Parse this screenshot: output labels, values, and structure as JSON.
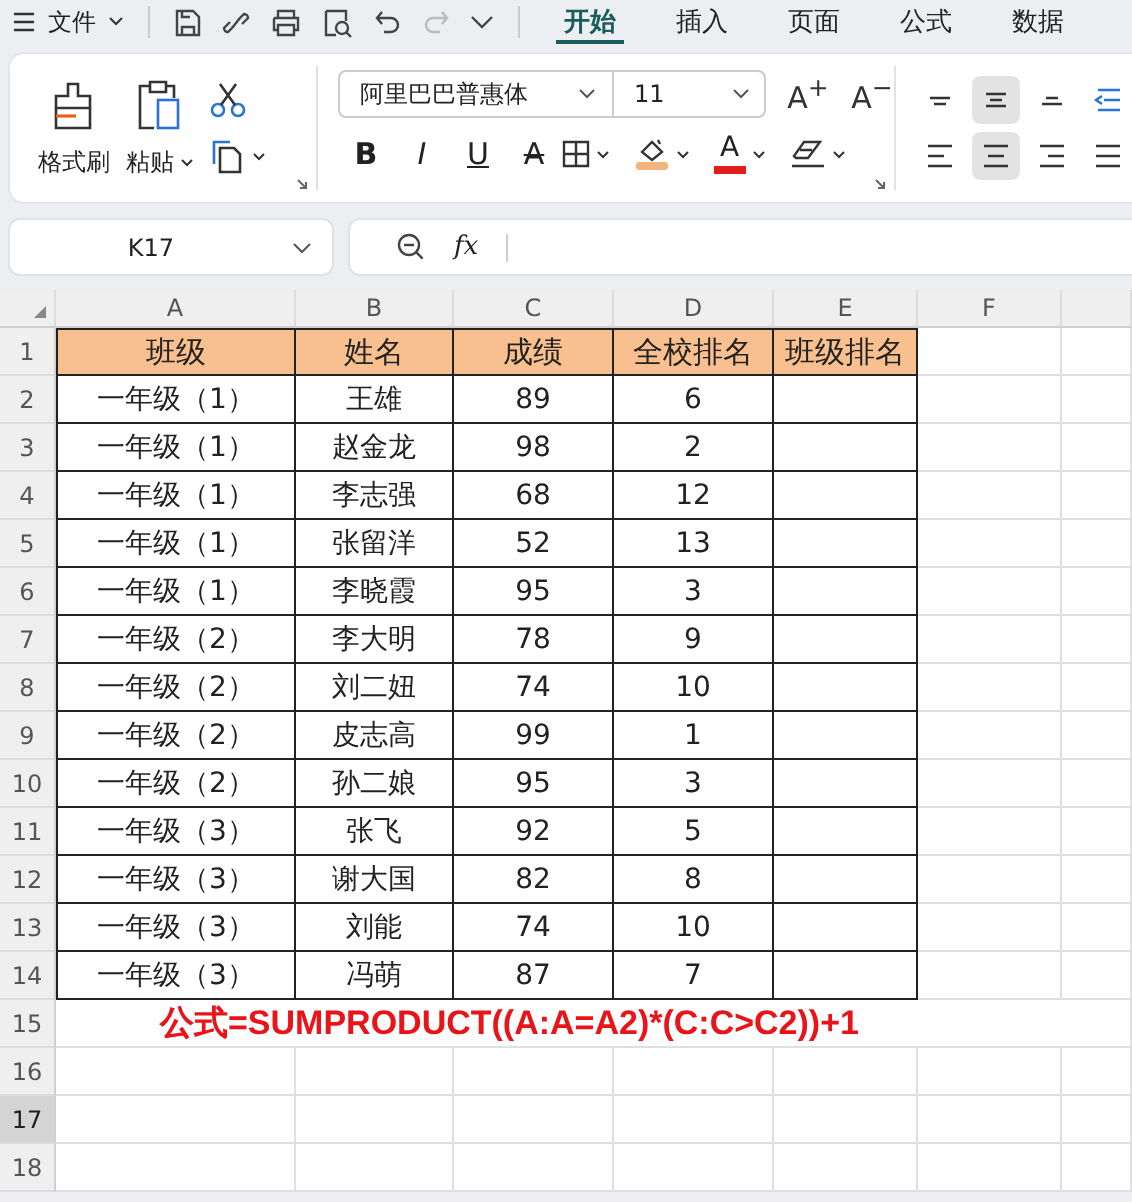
{
  "top_bar": {
    "menu_label": "文件",
    "tabs": [
      {
        "label": "开始",
        "selected": true
      },
      {
        "label": "插入",
        "selected": false
      },
      {
        "label": "页面",
        "selected": false
      },
      {
        "label": "公式",
        "selected": false
      },
      {
        "label": "数据",
        "selected": false
      }
    ]
  },
  "ribbon": {
    "format_painter_label": "格式刷",
    "paste_label": "粘贴",
    "font_name": "阿里巴巴普惠体",
    "font_size": "11",
    "grow_font": "A$^{+}$",
    "shrink_font": "A$^{−}$",
    "style_buttons": [
      {
        "kind": "bold",
        "label": "B"
      },
      {
        "kind": "italic",
        "label": "I"
      },
      {
        "kind": "underline",
        "label": "U"
      },
      {
        "kind": "strike",
        "label": "A"
      }
    ],
    "font_color_label": "A",
    "align_buttons": [
      {
        "kind": "top",
        "selected": false
      },
      {
        "kind": "middle",
        "selected": true
      },
      {
        "kind": "bottom",
        "selected": false
      },
      {
        "kind": "outdent",
        "selected": false
      },
      {
        "kind": "left",
        "selected": false
      },
      {
        "kind": "center",
        "selected": true
      },
      {
        "kind": "right",
        "selected": false
      },
      {
        "kind": "justify",
        "selected": false
      }
    ]
  },
  "formula_bar": {
    "name_box": "K17",
    "function_label": "fx"
  },
  "sheet": {
    "columns": [
      "A",
      "B",
      "C",
      "D",
      "E",
      "F"
    ],
    "row_numbers": [
      {
        "label": "1",
        "selected": false
      },
      {
        "label": "2",
        "selected": false
      },
      {
        "label": "3",
        "selected": false
      },
      {
        "label": "4",
        "selected": false
      },
      {
        "label": "5",
        "selected": false
      },
      {
        "label": "6",
        "selected": false
      },
      {
        "label": "7",
        "selected": false
      },
      {
        "label": "8",
        "selected": false
      },
      {
        "label": "9",
        "selected": false
      },
      {
        "label": "10",
        "selected": false
      },
      {
        "label": "11",
        "selected": false
      },
      {
        "label": "12",
        "selected": false
      },
      {
        "label": "13",
        "selected": false
      },
      {
        "label": "14",
        "selected": false
      },
      {
        "label": "15",
        "selected": false
      },
      {
        "label": "16",
        "selected": false
      },
      {
        "label": "17",
        "selected": true
      },
      {
        "label": "18",
        "selected": false
      }
    ],
    "header": [
      "班级",
      "姓名",
      "成绩",
      "全校排名",
      "班级排名"
    ],
    "rows": [
      [
        "一年级（1）",
        "王雄",
        "89",
        "6"
      ],
      [
        "一年级（1）",
        "赵金龙",
        "98",
        "2"
      ],
      [
        "一年级（1）",
        "李志强",
        "68",
        "12"
      ],
      [
        "一年级（1）",
        "张留洋",
        "52",
        "13"
      ],
      [
        "一年级（1）",
        "李晓霞",
        "95",
        "3"
      ],
      [
        "一年级（2）",
        "李大明",
        "78",
        "9"
      ],
      [
        "一年级（2）",
        "刘二妞",
        "74",
        "10"
      ],
      [
        "一年级（2）",
        "皮志高",
        "99",
        "1"
      ],
      [
        "一年级（2）",
        "孙二娘",
        "95",
        "3"
      ],
      [
        "一年级（3）",
        "张飞",
        "92",
        "5"
      ],
      [
        "一年级（3）",
        "谢大国",
        "82",
        "8"
      ],
      [
        "一年级（3）",
        "刘能",
        "74",
        "10"
      ],
      [
        "一年级（3）",
        "冯萌",
        "87",
        "7"
      ]
    ],
    "note": "公式=SUMPRODUCT((A:A=A2)*(C:C>C2))+1"
  }
}
